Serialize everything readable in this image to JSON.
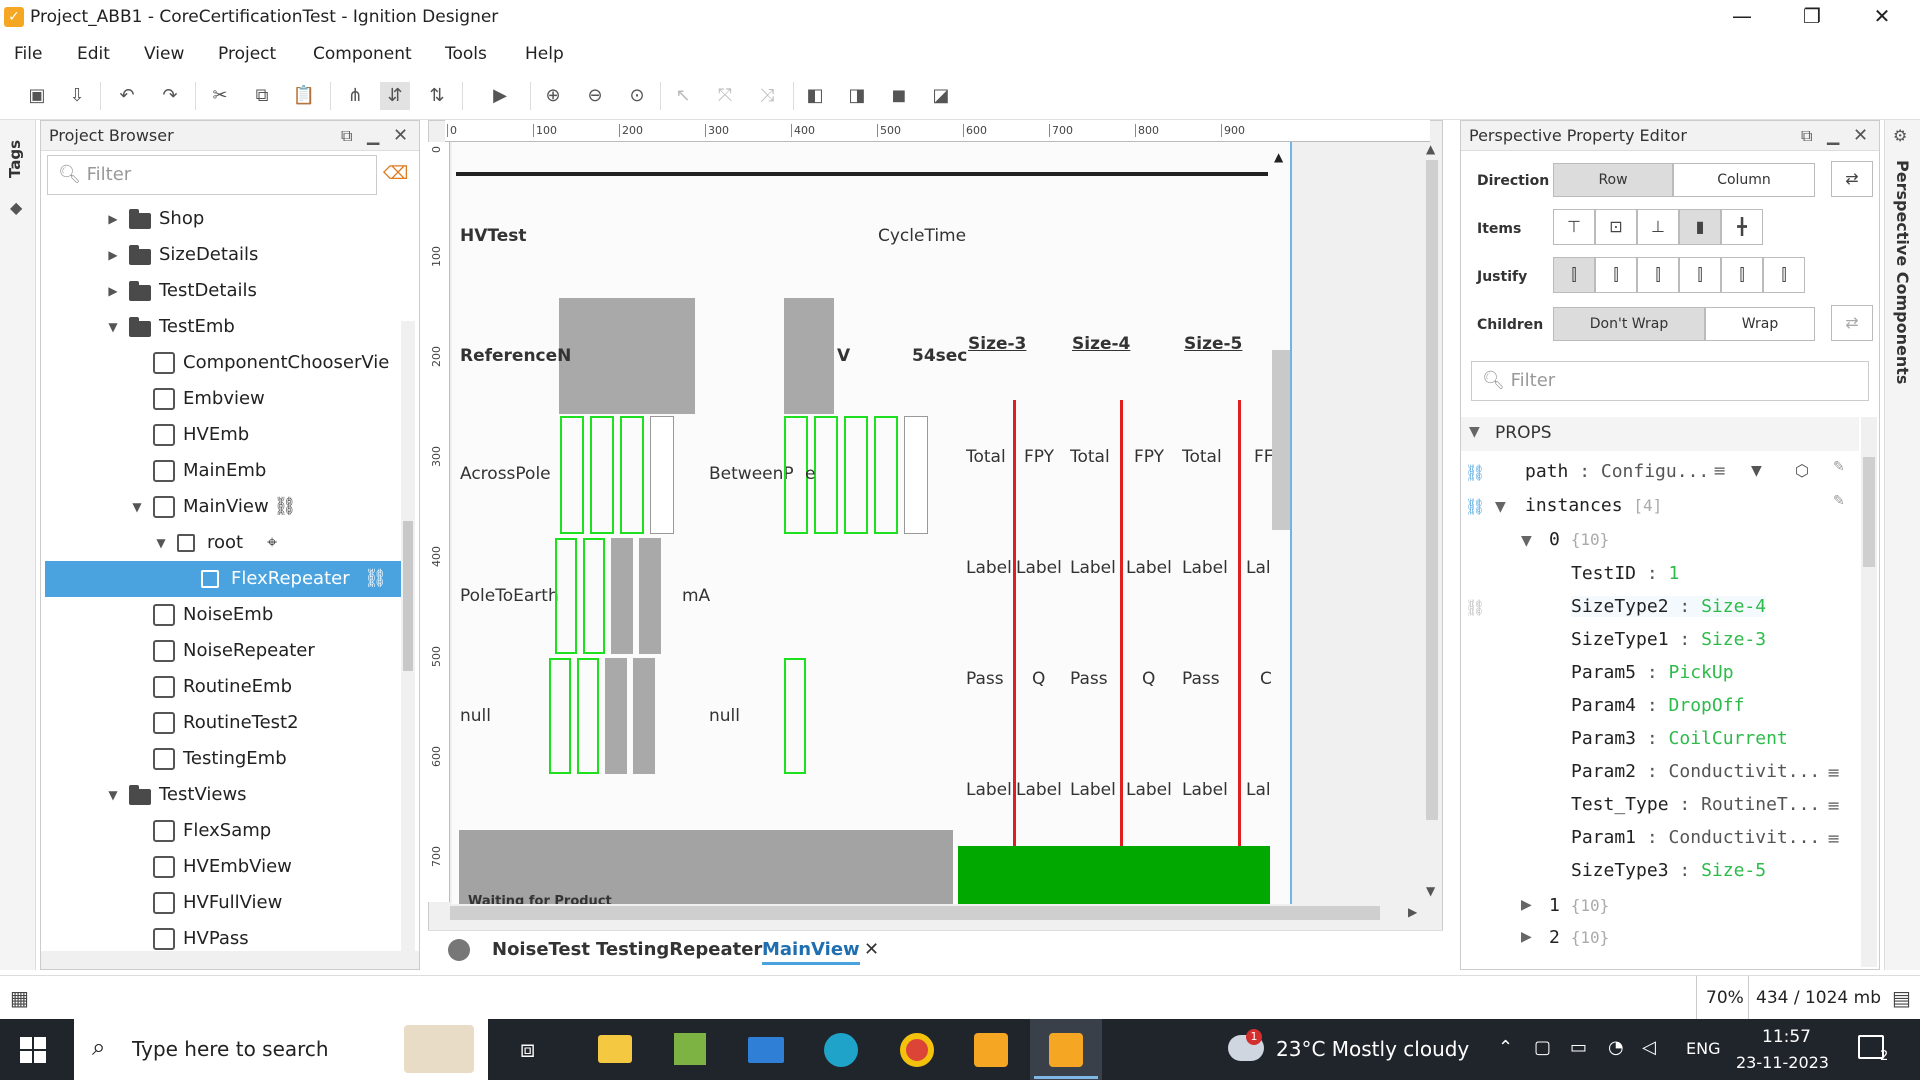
{
  "window": {
    "title": "Project_ABB1 - CoreCertificationTest - Ignition Designer",
    "minimize": "—",
    "restore": "❐",
    "close": "✕"
  },
  "menu": [
    "File",
    "Edit",
    "View",
    "Project",
    "Component",
    "Tools",
    "Help"
  ],
  "left_tab": "Tags",
  "project_browser": {
    "title": "Project Browser",
    "filter_placeholder": "Filter",
    "items": [
      {
        "label": "Shop",
        "type": "folder",
        "depth": 0,
        "expanded": false
      },
      {
        "label": "SizeDetails",
        "type": "folder",
        "depth": 0,
        "expanded": false
      },
      {
        "label": "TestDetails",
        "type": "folder",
        "depth": 0,
        "expanded": false
      },
      {
        "label": "TestEmb",
        "type": "folder",
        "depth": 0,
        "expanded": true
      },
      {
        "label": "ComponentChooserVie",
        "type": "view",
        "depth": 1
      },
      {
        "label": "Embview",
        "type": "view",
        "depth": 1
      },
      {
        "label": "HVEmb",
        "type": "view",
        "depth": 1
      },
      {
        "label": "MainEmb",
        "type": "view",
        "depth": 1
      },
      {
        "label": "MainView",
        "type": "view",
        "depth": 1,
        "expanded": true
      },
      {
        "label": "root",
        "type": "container",
        "depth": 2,
        "expanded": true
      },
      {
        "label": "FlexRepeater",
        "type": "component",
        "depth": 3,
        "selected": true
      },
      {
        "label": "NoiseEmb",
        "type": "view",
        "depth": 1
      },
      {
        "label": "NoiseRepeater",
        "type": "view",
        "depth": 1
      },
      {
        "label": "RoutineEmb",
        "type": "view",
        "depth": 1
      },
      {
        "label": "RoutineTest2",
        "type": "view",
        "depth": 1
      },
      {
        "label": "TestingEmb",
        "type": "view",
        "depth": 1
      },
      {
        "label": "TestViews",
        "type": "folder",
        "depth": 0,
        "expanded": true
      },
      {
        "label": "FlexSamp",
        "type": "view",
        "depth": 1
      },
      {
        "label": "HVEmbView",
        "type": "view",
        "depth": 1
      },
      {
        "label": "HVFullView",
        "type": "view",
        "depth": 1
      },
      {
        "label": "HVPass",
        "type": "view",
        "depth": 1
      }
    ]
  },
  "ruler_top": [
    "0",
    "100",
    "200",
    "300",
    "400",
    "500",
    "600",
    "700",
    "800",
    "900"
  ],
  "ruler_left": [
    "0",
    "100",
    "200",
    "300",
    "400",
    "500",
    "600",
    "700"
  ],
  "canvas": {
    "hvtest": "HVTest",
    "cycletime": "CycleTime",
    "referencen": "ReferenceN",
    "v": "V",
    "sec54": "54sec",
    "sizes": [
      "Size-3",
      "Size-4",
      "Size-5"
    ],
    "acrosspole": "AcrossPole",
    "betweenp": "BetweenP",
    "e": "e",
    "poletoearth": "PoleToEarth",
    "ma": "mA",
    "null1": "null",
    "null2": "null",
    "waiting": "Waiting for Product",
    "row_total": [
      "Total",
      "FPY",
      "Total",
      "FPY",
      "Total",
      "FF"
    ],
    "row_label1": [
      "Label",
      "Label",
      "Label",
      "Label",
      "Label",
      "Lal"
    ],
    "row_pass": [
      "Pass",
      "Q",
      "Pass",
      "Q",
      "Pass",
      "C"
    ],
    "row_label2": [
      "Label",
      "Label",
      "Label",
      "Label",
      "Label",
      "Lal"
    ]
  },
  "tabs": [
    "NoiseTest",
    "TestingRepeater",
    "MainView"
  ],
  "tab_close": "✕",
  "property_editor": {
    "title": "Perspective Property Editor",
    "direction_label": "Direction",
    "direction": [
      "Row",
      "Column"
    ],
    "items_label": "Items",
    "justify_label": "Justify",
    "children_label": "Children",
    "children": [
      "Don't Wrap",
      "Wrap"
    ],
    "filter_placeholder": "Filter",
    "props_label": "PROPS",
    "path_key": "path",
    "path_value": "Configu...",
    "instances_key": "instances",
    "instances_count": "[4]",
    "inst0": "0",
    "inst0_count": "{10}",
    "fields": [
      {
        "k": "TestID",
        "v": "1",
        "style": "green"
      },
      {
        "k": "SizeType2",
        "v": "Size-4",
        "style": "green"
      },
      {
        "k": "SizeType1",
        "v": "Size-3",
        "style": "green"
      },
      {
        "k": "Param5",
        "v": "PickUp",
        "style": "green"
      },
      {
        "k": "Param4",
        "v": "DropOff",
        "style": "green"
      },
      {
        "k": "Param3",
        "v": "CoilCurrent",
        "style": "green"
      },
      {
        "k": "Param2",
        "v": "Conductivit...",
        "style": "grey"
      },
      {
        "k": "Test_Type",
        "v": "RoutineT...",
        "style": "grey"
      },
      {
        "k": "Param1",
        "v": "Conductivit...",
        "style": "grey"
      },
      {
        "k": "SizeType3",
        "v": "Size-5",
        "style": "green"
      }
    ],
    "inst1": "1",
    "inst1_count": "{10}",
    "inst2": "2",
    "inst2_count": "{10}"
  },
  "right_tab": "Perspective Components",
  "status": {
    "zoom": "70%",
    "memory": "434 / 1024 mb"
  },
  "taskbar": {
    "search": "Type here to search",
    "weather": "23°C  Mostly cloudy",
    "lang": "ENG",
    "time": "11:57",
    "date": "23-11-2023",
    "notif": "2",
    "weather_badge": "1"
  }
}
